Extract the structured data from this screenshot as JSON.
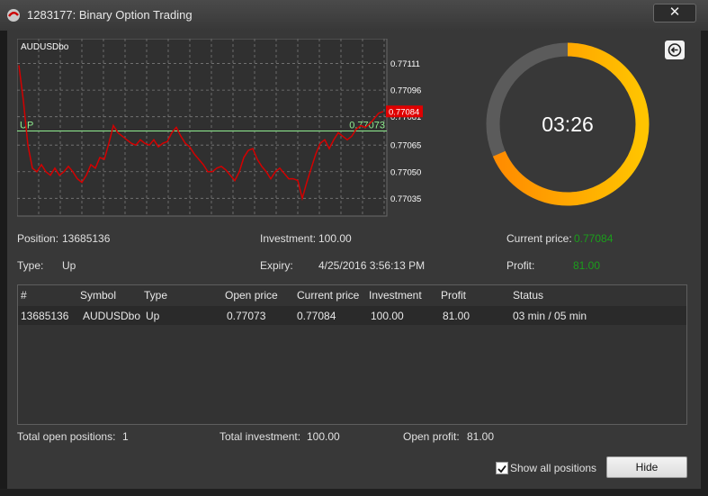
{
  "window": {
    "title": "1283177: Binary Option Trading",
    "close_glyph": "✕"
  },
  "chart": {
    "symbol": "AUDUSDbo",
    "up_label": "UP",
    "up_value": "0.77073",
    "current_tag": "0.77084",
    "y_ticks": [
      "0.77111",
      "0.77096",
      "0.77081",
      "0.77065",
      "0.77050",
      "0.77035"
    ],
    "price_series": [
      0.7711,
      0.7709,
      0.77065,
      0.77052,
      0.7705,
      0.77054,
      0.7705,
      0.77048,
      0.77052,
      0.77048,
      0.7705,
      0.77053,
      0.7705,
      0.77046,
      0.77044,
      0.77048,
      0.77054,
      0.77052,
      0.77058,
      0.77057,
      0.77066,
      0.77076,
      0.77072,
      0.7707,
      0.77068,
      0.77066,
      0.77065,
      0.77068,
      0.77066,
      0.77065,
      0.77068,
      0.77064,
      0.77066,
      0.77067,
      0.77072,
      0.77075,
      0.7707,
      0.77066,
      0.77064,
      0.7706,
      0.77057,
      0.77054,
      0.7705,
      0.7705,
      0.77052,
      0.77053,
      0.77051,
      0.77048,
      0.77045,
      0.7705,
      0.77058,
      0.77062,
      0.77063,
      0.77057,
      0.77053,
      0.7705,
      0.77046,
      0.7705,
      0.77052,
      0.77049,
      0.77046,
      0.77046,
      0.77045,
      0.77035,
      0.77044,
      0.77052,
      0.7706,
      0.77066,
      0.77068,
      0.77063,
      0.77068,
      0.77072,
      0.7707,
      0.77068,
      0.7707,
      0.77074,
      0.77076,
      0.77075,
      0.77077,
      0.7708,
      0.77083,
      0.77084
    ]
  },
  "timer": {
    "text": "03:26",
    "remaining_fraction": 0.685,
    "color_remaining_start": "#ff8a00",
    "color_remaining_end": "#ffc400",
    "color_elapsed": "#5b5b5b"
  },
  "details": {
    "position_label": "Position:",
    "position_value": "13685136",
    "investment_label": "Investment:",
    "investment_value": "100.00",
    "current_price_label": "Current price:",
    "current_price_value": "0.77084",
    "type_label": "Type:",
    "type_value": "Up",
    "expiry_label": "Expiry:",
    "expiry_value": "4/25/2016 3:56:13 PM",
    "profit_label": "Profit:",
    "profit_value": "81.00"
  },
  "table": {
    "headers": [
      "#",
      "Symbol",
      "Type",
      "Open price",
      "Current price",
      "Investment",
      "Profit",
      "Status"
    ],
    "rows": [
      [
        "13685136",
        "AUDUSDbo",
        "Up",
        "0.77073",
        "0.77084",
        "100.00",
        "81.00",
        "03 min / 05 min"
      ]
    ]
  },
  "footer": {
    "total_open_label": "Total open positions:",
    "total_open_value": "1",
    "total_investment_label": "Total investment:",
    "total_investment_value": "100.00",
    "open_profit_label": "Open profit:",
    "open_profit_value": "81.00",
    "show_all_label": "Show all positions",
    "show_all_checked": true,
    "hide_label": "Hide"
  },
  "colors": {
    "up_line": "#90ee90",
    "price_line": "#d40000",
    "current_tag_bg": "#e00000",
    "positive": "#1b9e1b"
  }
}
